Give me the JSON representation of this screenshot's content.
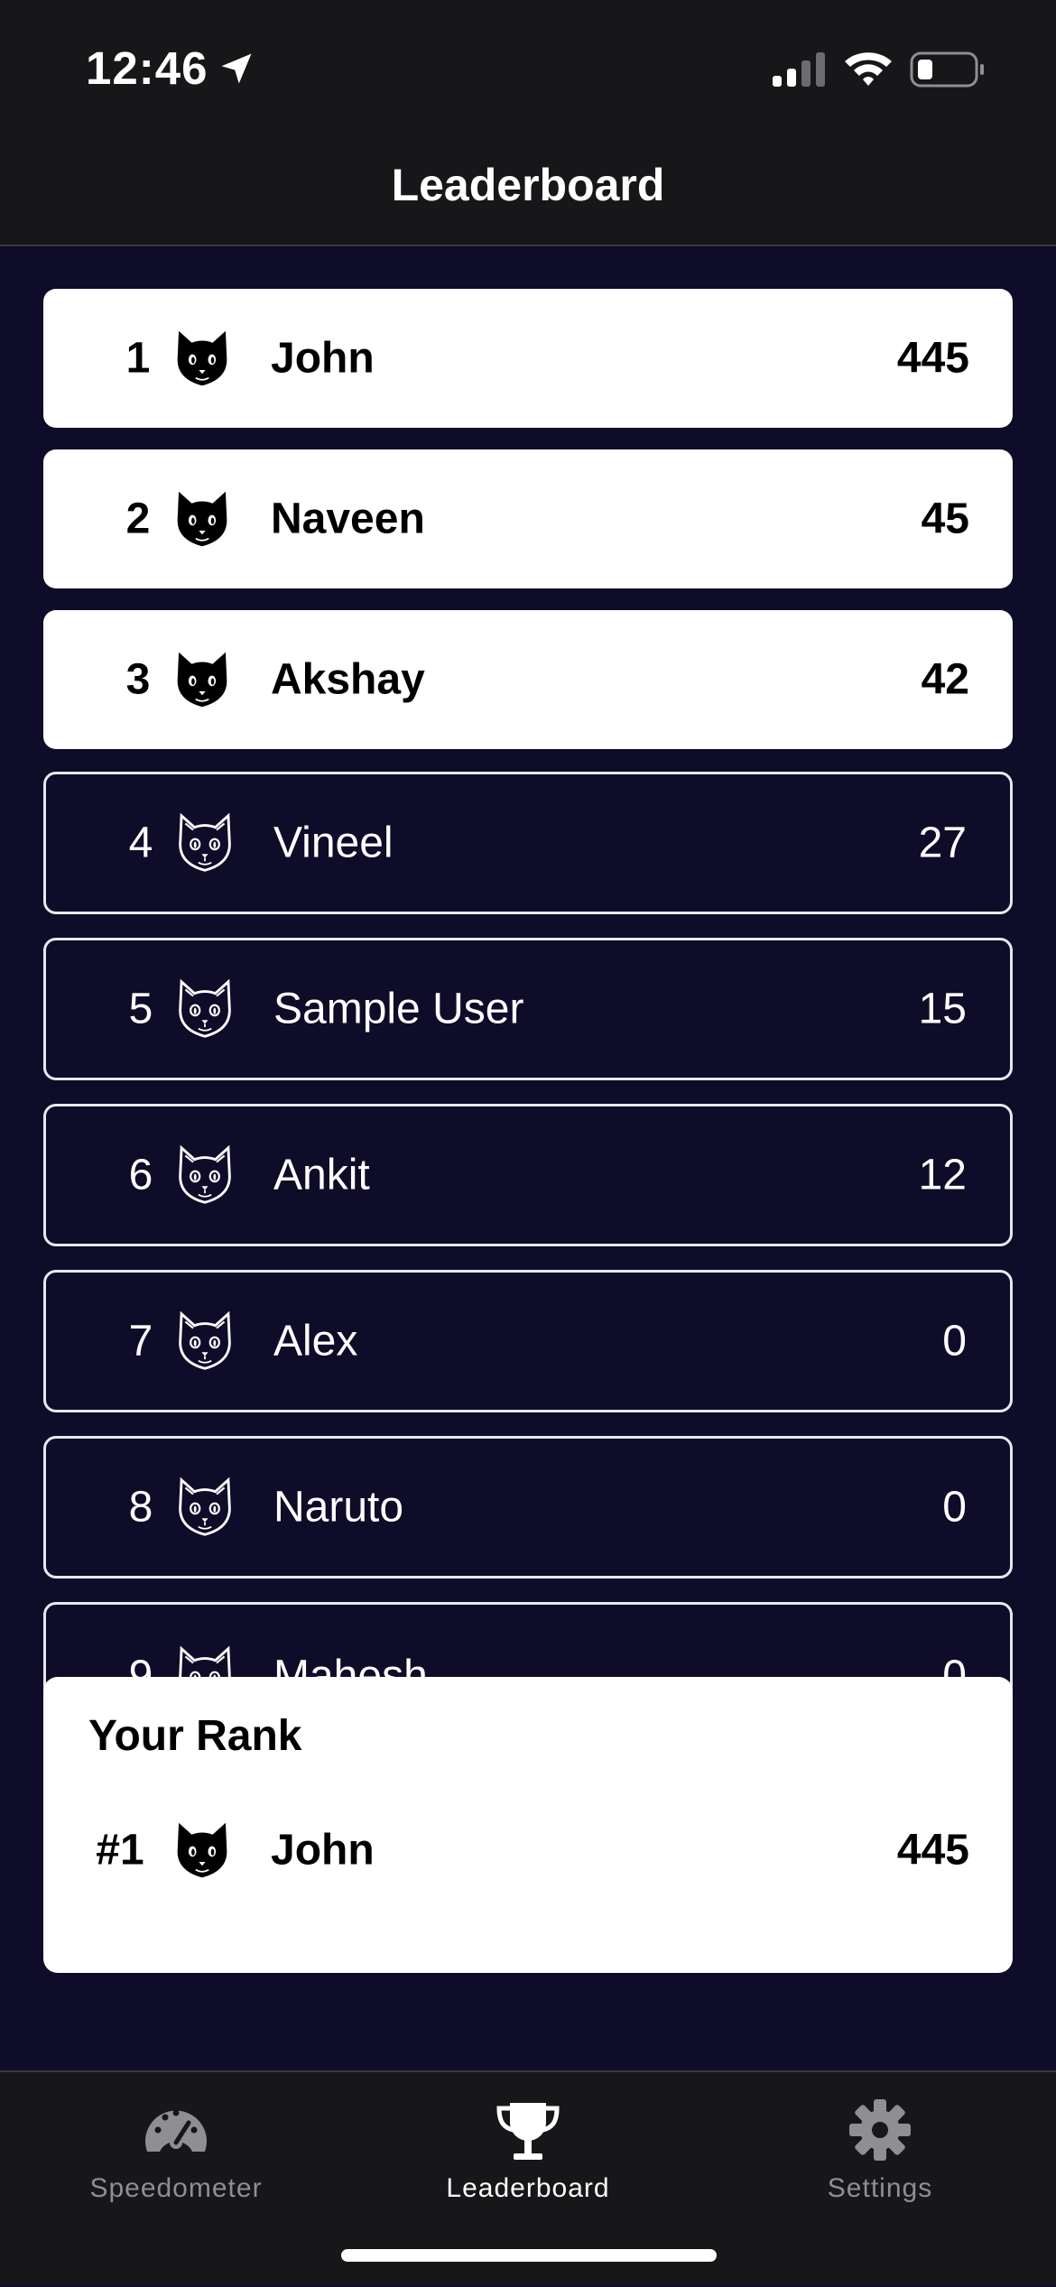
{
  "status": {
    "time": "12:46"
  },
  "header": {
    "title": "Leaderboard"
  },
  "leaderboard": [
    {
      "rank": "1",
      "name": "John",
      "score": "445"
    },
    {
      "rank": "2",
      "name": "Naveen",
      "score": "45"
    },
    {
      "rank": "3",
      "name": "Akshay",
      "score": "42"
    },
    {
      "rank": "4",
      "name": "Vineel",
      "score": "27"
    },
    {
      "rank": "5",
      "name": "Sample User",
      "score": "15"
    },
    {
      "rank": "6",
      "name": "Ankit",
      "score": "12"
    },
    {
      "rank": "7",
      "name": "Alex",
      "score": "0"
    },
    {
      "rank": "8",
      "name": "Naruto",
      "score": "0"
    },
    {
      "rank": "9",
      "name": "Mahesh",
      "score": "0"
    }
  ],
  "your_rank": {
    "title": "Your Rank",
    "rank": "#1",
    "name": "John",
    "score": "445"
  },
  "tabs": [
    {
      "label": "Speedometer",
      "icon": "speedometer-icon",
      "active": false
    },
    {
      "label": "Leaderboard",
      "icon": "trophy-icon",
      "active": true
    },
    {
      "label": "Settings",
      "icon": "gear-icon",
      "active": false
    }
  ],
  "colors": {
    "background": "#0e0c28",
    "bar": "#17171a",
    "active_tab": "#ffffff",
    "inactive_tab": "#8e8e93"
  }
}
